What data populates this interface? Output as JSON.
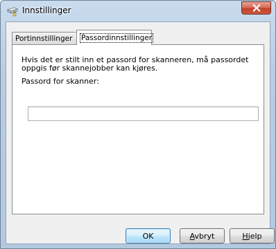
{
  "window": {
    "title": "Innstillinger"
  },
  "tabs": [
    {
      "label": "Portinnstillinger",
      "active": false
    },
    {
      "label": "Passordinnstillinger",
      "active": true
    }
  ],
  "panel": {
    "info_text": "Hvis det er stilt inn et passord for skanneren, må passordet oppgis før skannejobber kan kjøres.",
    "password_label": "Passord for skanner:",
    "password_value": ""
  },
  "buttons": {
    "ok": "OK",
    "cancel_mnemonic": "A",
    "cancel_rest": "vbryt",
    "help_mnemonic": "H",
    "help_rest": "jelp"
  },
  "colors": {
    "close_button": "#c0412a",
    "title_bar": "#b8cde3",
    "dialog_bg": "#f0f0f0"
  },
  "icons": {
    "title": "scanner-icon",
    "close": "close-icon"
  }
}
